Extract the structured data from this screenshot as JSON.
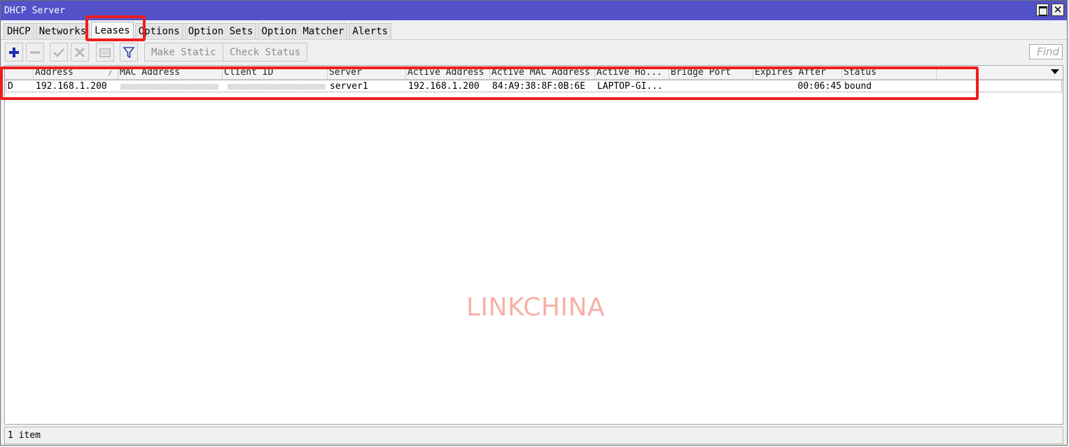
{
  "window": {
    "title": "DHCP Server",
    "maximize_glyph": "",
    "close_glyph": "✕"
  },
  "tabs": [
    {
      "label": "DHCP",
      "active": false
    },
    {
      "label": "Networks",
      "active": false
    },
    {
      "label": "Leases",
      "active": true
    },
    {
      "label": "Options",
      "active": false
    },
    {
      "label": "Option Sets",
      "active": false
    },
    {
      "label": "Option Matcher",
      "active": false
    },
    {
      "label": "Alerts",
      "active": false
    }
  ],
  "toolbar": {
    "icons": [
      "add-icon",
      "remove-icon",
      "enable-icon",
      "disable-icon",
      "comment-icon",
      "filter-icon"
    ],
    "make_static_label": "Make Static",
    "check_status_label": "Check Status",
    "find_placeholder": "Find"
  },
  "table": {
    "columns": [
      "",
      "Address",
      "MAC Address",
      "Client ID",
      "Server",
      "Active Address",
      "Active MAC Address",
      "Active Ho...",
      "Bridge Port",
      "Expires After",
      "Status",
      ""
    ],
    "sort_indicator": "/",
    "rows": [
      {
        "flag": "D",
        "address": "192.168.1.200",
        "mac_address": "",
        "client_id": "",
        "server": "server1",
        "active_address": "192.168.1.200",
        "active_mac_address": "84:A9:38:8F:0B:6E",
        "active_host": "LAPTOP-GI...",
        "bridge_port": "",
        "expires_after": "00:06:45",
        "status": "bound"
      }
    ]
  },
  "watermark": "LINKCHINA",
  "status_bar": {
    "text": "1 item"
  },
  "colors": {
    "titlebar": "#5352c9",
    "highlight": "#ee1d1d",
    "add_icon": "#1a2bb8",
    "filter_icon": "#2a3fa8"
  }
}
